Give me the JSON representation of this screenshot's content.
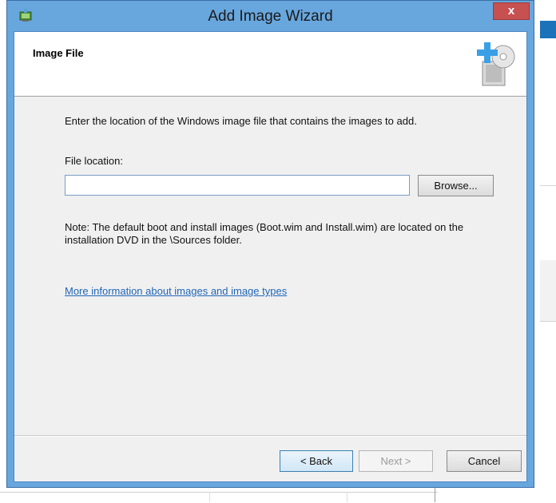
{
  "window": {
    "title": "Add Image Wizard",
    "close_label": "x",
    "accent_color": "#68a7de"
  },
  "header": {
    "page_title": "Image File",
    "icon_name": "add-image-disc-icon"
  },
  "main": {
    "instructions": "Enter the location of the Windows image file that contains the images to add.",
    "file_location_label": "File location:",
    "file_location_value": "",
    "browse_label": "Browse...",
    "note": "Note: The default boot and install images (Boot.wim and Install.wim) are located on the installation DVD in the \\Sources folder.",
    "more_info_link": "More information about images and image types"
  },
  "footer": {
    "back_label": "< Back",
    "next_label": "Next >",
    "cancel_label": "Cancel",
    "next_enabled": false
  }
}
